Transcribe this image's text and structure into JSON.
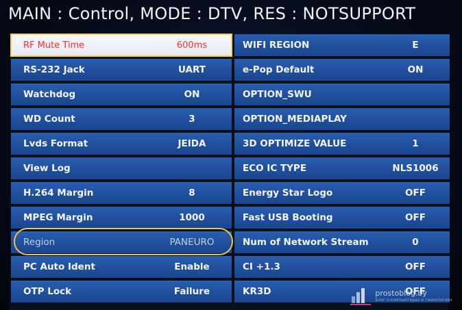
{
  "header": {
    "title": "MAIN : Control, MODE : DTV, RES : NOTSUPPORT"
  },
  "colors": {
    "row_blue": "#2159a6",
    "selected_bg": "#f2f4f9",
    "selected_text": "#ff2a2a",
    "highlight_yellow": "#f2c640"
  },
  "left_items": [
    {
      "label": "RF Mute Time",
      "value": "600ms",
      "state": "selected"
    },
    {
      "label": "RS-232 Jack",
      "value": "UART"
    },
    {
      "label": "Watchdog",
      "value": "ON"
    },
    {
      "label": "WD Count",
      "value": "3"
    },
    {
      "label": "Lvds Format",
      "value": "JEIDA"
    },
    {
      "label": "View Log",
      "value": ""
    },
    {
      "label": "H.264 Margin",
      "value": "8"
    },
    {
      "label": "MPEG Margin",
      "value": "1000"
    },
    {
      "label": "Region",
      "value": "PANEURO",
      "state": "circled"
    },
    {
      "label": "PC Auto Ident",
      "value": "Enable"
    },
    {
      "label": "OTP Lock",
      "value": "Failure"
    }
  ],
  "right_items": [
    {
      "label": "WIFI REGION",
      "value": "E"
    },
    {
      "label": "e-Pop Default",
      "value": "ON"
    },
    {
      "label": "OPTION_SWU",
      "value": ""
    },
    {
      "label": "OPTION_MEDIAPLAY",
      "value": ""
    },
    {
      "label": "3D OPTIMIZE VALUE",
      "value": "1"
    },
    {
      "label": "ECO IC TYPE",
      "value": "NLS1006"
    },
    {
      "label": "Energy Star Logo",
      "value": "OFF"
    },
    {
      "label": "Fast USB Booting",
      "value": "OFF"
    },
    {
      "label": "Num of Network Stream",
      "value": "0"
    },
    {
      "label": "CI +1.3",
      "value": "OFF"
    },
    {
      "label": "KR3D",
      "value": "OFF"
    }
  ],
  "watermark": {
    "text": "prostoblog.by",
    "subtext": "Блог о компьютерах и технологиях"
  }
}
